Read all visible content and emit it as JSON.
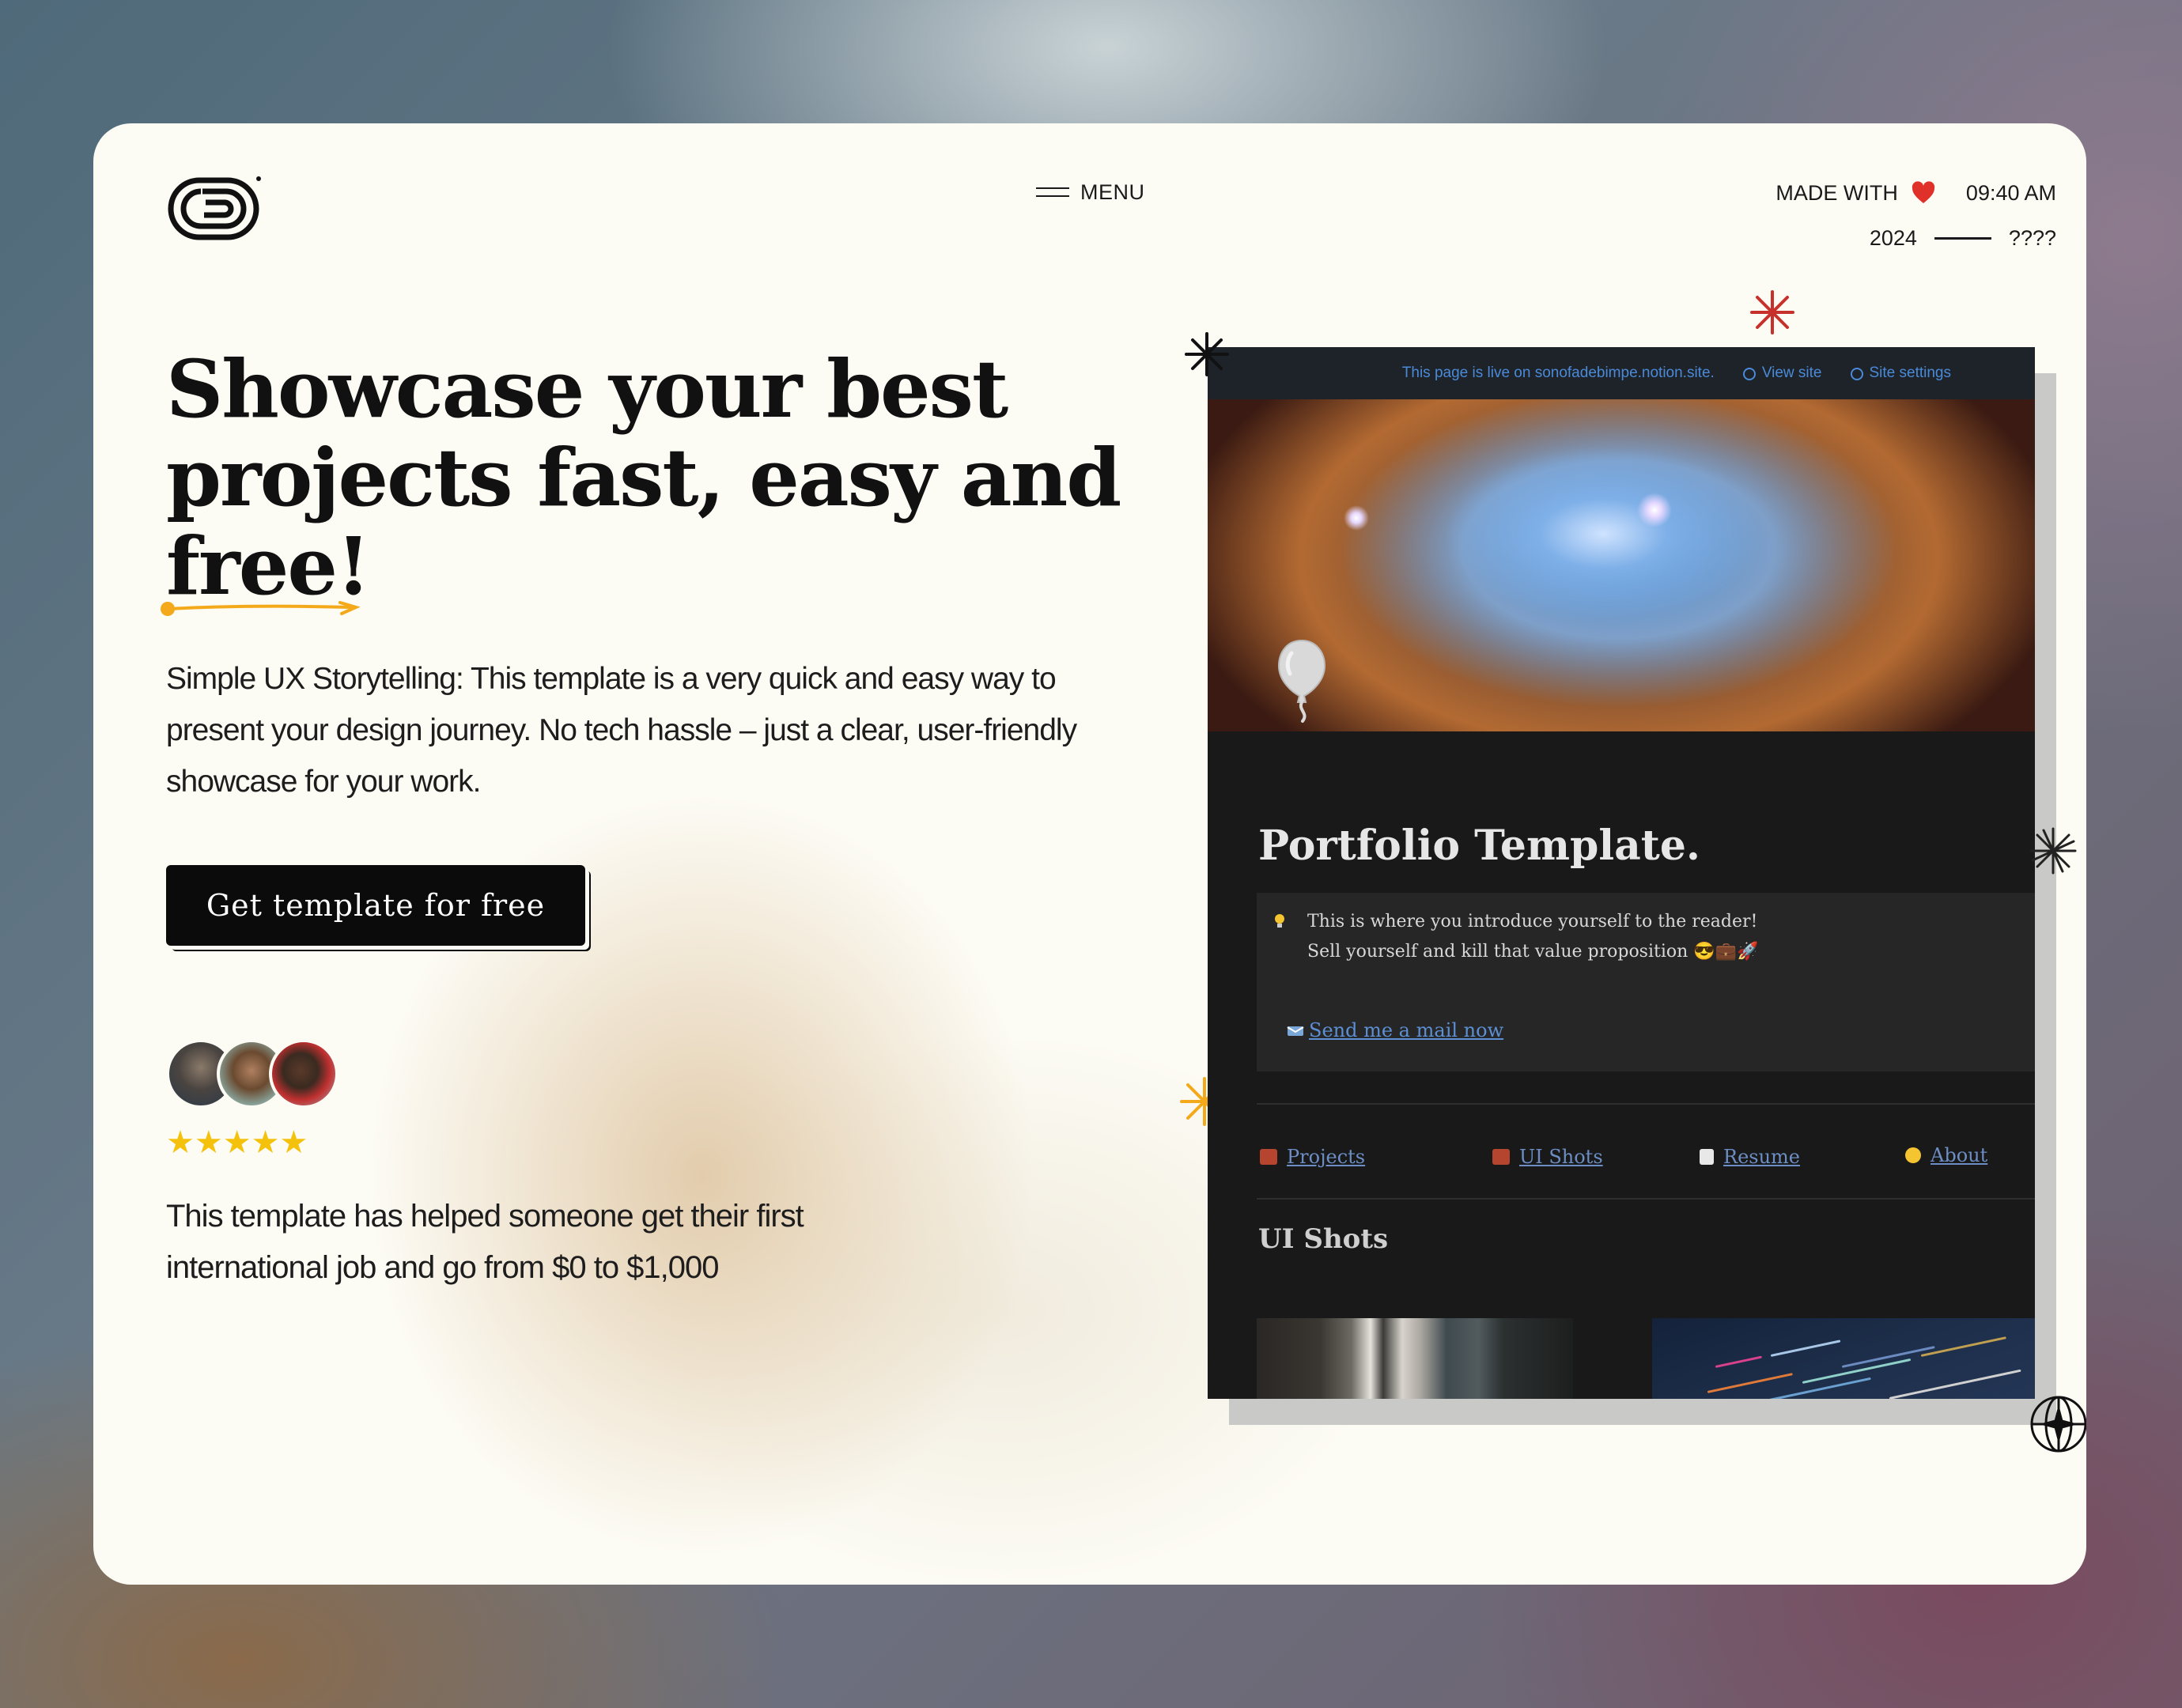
{
  "header": {
    "menu_label": "MENU",
    "made_with_label": "MADE WITH",
    "time": "09:40 AM",
    "year": "2024",
    "year_end": "????"
  },
  "hero": {
    "headline": "Showcase your best projects fast, easy and free!",
    "subtext": "Simple UX Storytelling: This template is a very quick and easy way to present your design journey. No tech hassle – just a clear, user-friendly showcase for your work.",
    "cta_label": "Get template for free",
    "rating_stars": "★★★★★",
    "testimonial": "This template has helped someone get their first international job and go from $0 to $1,000"
  },
  "preview": {
    "live_bar_text": "This page is live on sonofadebimpe.notion.site.",
    "view_site": "View site",
    "site_settings": "Site settings",
    "title": "Portfolio Template.",
    "callout_line1": "This is where you introduce yourself to the reader!",
    "callout_line2": "Sell yourself and kill that value proposition 😎💼🚀",
    "mail_link": "Send me a mail now",
    "nav": [
      "Projects",
      "UI Shots",
      "Resume",
      "About"
    ],
    "section_title": "UI Shots"
  },
  "colors": {
    "accent_yellow": "#f4a91a",
    "star_red": "#c7312b",
    "card_bg": "#fcfbf4",
    "button_bg": "#0b0b0b",
    "link_blue": "#4a8ad8"
  },
  "icons": {
    "logo": "loop-logo-icon",
    "menu": "hamburger-icon",
    "heart": "heart-icon",
    "globe": "globe-icon",
    "gear": "gear-icon"
  }
}
